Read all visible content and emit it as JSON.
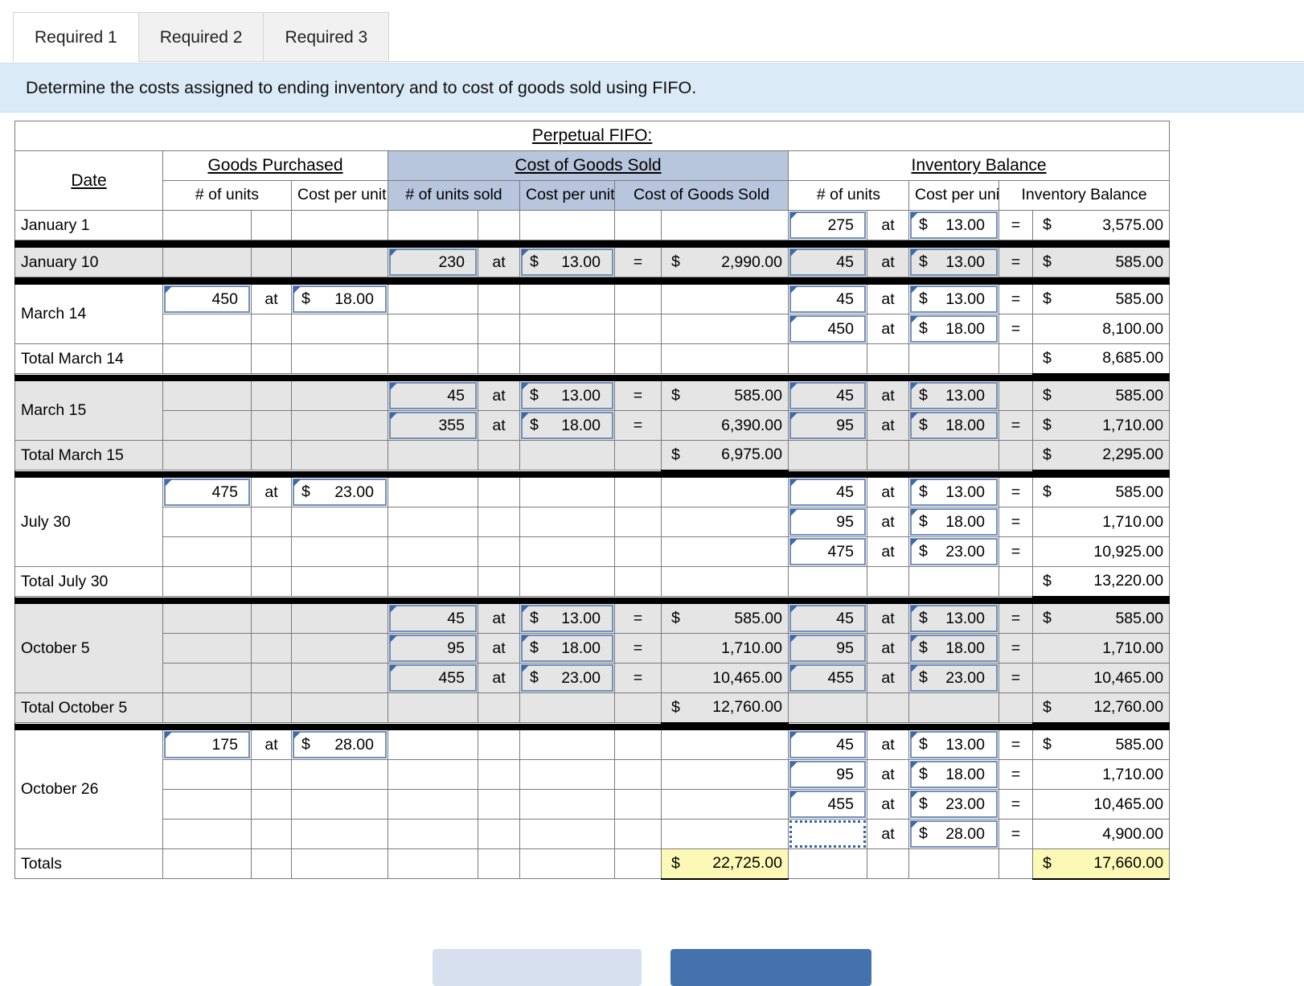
{
  "tabs": [
    {
      "label": "Required 1",
      "active": true
    },
    {
      "label": "Required 2",
      "active": false
    },
    {
      "label": "Required 3",
      "active": false
    }
  ],
  "prompt": "Determine the costs assigned to ending inventory and to cost of goods sold using FIFO.",
  "table": {
    "title": "Perpetual FIFO:",
    "group_headers": {
      "date": "Date",
      "goods_purchased": "Goods Purchased",
      "cost_of_goods_sold": "Cost of Goods Sold",
      "inventory_balance": "Inventory Balance"
    },
    "sub_headers": {
      "gp_units": "# of units",
      "gp_cost": "Cost per unit",
      "cogs_units": "# of units sold",
      "cogs_cost": "Cost per unit",
      "cogs_total": "Cost of Goods Sold",
      "inv_units": "# of units",
      "inv_cost": "Cost per unit",
      "inv_total": "Inventory Balance"
    },
    "ops": {
      "at": "at",
      "eq": "=",
      "dollar": "$"
    },
    "rows": [
      {
        "date": "January 1",
        "band": false,
        "lines": [
          {
            "gp_units": "",
            "gp_cost": "",
            "cogs_units": "",
            "cogs_cost": "",
            "cogs_total": "",
            "inv_units": "275",
            "inv_cost": "13.00",
            "inv_total": "3,575.00",
            "inv_total_sym": "$",
            "inv_eq": "="
          }
        ]
      },
      {
        "date": "January 10",
        "band": true,
        "lines": [
          {
            "gp_units": "",
            "gp_cost": "",
            "cogs_units": "230",
            "cogs_cost": "13.00",
            "cogs_total": "2,990.00",
            "cogs_total_sym": "$",
            "cogs_eq": "=",
            "inv_units": "45",
            "inv_cost": "13.00",
            "inv_total": "585.00",
            "inv_total_sym": "$",
            "inv_eq": "="
          }
        ]
      },
      {
        "date": "March 14",
        "band": false,
        "lines": [
          {
            "gp_units": "450",
            "gp_cost": "18.00",
            "cogs_units": "",
            "cogs_cost": "",
            "cogs_total": "",
            "inv_units": "45",
            "inv_cost": "13.00",
            "inv_total": "585.00",
            "inv_total_sym": "$",
            "inv_eq": "="
          },
          {
            "gp_units": "",
            "gp_cost": "",
            "cogs_units": "",
            "cogs_cost": "",
            "cogs_total": "",
            "inv_units": "450",
            "inv_cost": "18.00",
            "inv_total": "8,100.00",
            "inv_total_sym": "",
            "inv_eq": "="
          }
        ],
        "total_label": "Total March 14",
        "total_cogs": "",
        "total_cogs_sym": "",
        "total_inv": "8,685.00",
        "total_inv_sym": "$"
      },
      {
        "date": "March 15",
        "band": true,
        "lines": [
          {
            "gp_units": "",
            "gp_cost": "",
            "cogs_units": "45",
            "cogs_cost": "13.00",
            "cogs_total": "585.00",
            "cogs_total_sym": "$",
            "cogs_eq": "=",
            "inv_units": "45",
            "inv_cost": "13.00",
            "inv_total": "585.00",
            "inv_total_sym": "$",
            "inv_eq": ""
          },
          {
            "gp_units": "",
            "gp_cost": "",
            "cogs_units": "355",
            "cogs_cost": "18.00",
            "cogs_total": "6,390.00",
            "cogs_total_sym": "",
            "cogs_eq": "=",
            "inv_units": "95",
            "inv_cost": "18.00",
            "inv_total": "1,710.00",
            "inv_total_sym": "$",
            "inv_eq": "="
          }
        ],
        "total_label": "Total March 15",
        "total_cogs": "6,975.00",
        "total_cogs_sym": "$",
        "total_inv": "2,295.00",
        "total_inv_sym": "$"
      },
      {
        "date": "July 30",
        "band": false,
        "lines": [
          {
            "gp_units": "475",
            "gp_cost": "23.00",
            "cogs_units": "",
            "cogs_cost": "",
            "cogs_total": "",
            "inv_units": "45",
            "inv_cost": "13.00",
            "inv_total": "585.00",
            "inv_total_sym": "$",
            "inv_eq": "="
          },
          {
            "gp_units": "",
            "gp_cost": "",
            "cogs_units": "",
            "cogs_cost": "",
            "cogs_total": "",
            "inv_units": "95",
            "inv_cost": "18.00",
            "inv_total": "1,710.00",
            "inv_total_sym": "",
            "inv_eq": "="
          },
          {
            "gp_units": "",
            "gp_cost": "",
            "cogs_units": "",
            "cogs_cost": "",
            "cogs_total": "",
            "inv_units": "475",
            "inv_cost": "23.00",
            "inv_total": "10,925.00",
            "inv_total_sym": "",
            "inv_eq": "="
          }
        ],
        "total_label": "Total July 30",
        "total_cogs": "",
        "total_cogs_sym": "",
        "total_inv": "13,220.00",
        "total_inv_sym": "$"
      },
      {
        "date": "October 5",
        "band": true,
        "lines": [
          {
            "gp_units": "",
            "gp_cost": "",
            "cogs_units": "45",
            "cogs_cost": "13.00",
            "cogs_total": "585.00",
            "cogs_total_sym": "$",
            "cogs_eq": "=",
            "inv_units": "45",
            "inv_cost": "13.00",
            "inv_total": "585.00",
            "inv_total_sym": "$",
            "inv_eq": "="
          },
          {
            "gp_units": "",
            "gp_cost": "",
            "cogs_units": "95",
            "cogs_cost": "18.00",
            "cogs_total": "1,710.00",
            "cogs_total_sym": "",
            "cogs_eq": "=",
            "inv_units": "95",
            "inv_cost": "18.00",
            "inv_total": "1,710.00",
            "inv_total_sym": "",
            "inv_eq": "="
          },
          {
            "gp_units": "",
            "gp_cost": "",
            "cogs_units": "455",
            "cogs_cost": "23.00",
            "cogs_total": "10,465.00",
            "cogs_total_sym": "",
            "cogs_eq": "=",
            "inv_units": "455",
            "inv_cost": "23.00",
            "inv_total": "10,465.00",
            "inv_total_sym": "",
            "inv_eq": "="
          }
        ],
        "total_label": "Total October 5",
        "total_cogs": "12,760.00",
        "total_cogs_sym": "$",
        "total_inv": "12,760.00",
        "total_inv_sym": "$"
      },
      {
        "date": "October 26",
        "band": false,
        "lines": [
          {
            "gp_units": "175",
            "gp_cost": "28.00",
            "cogs_units": "",
            "cogs_cost": "",
            "cogs_total": "",
            "inv_units": "45",
            "inv_cost": "13.00",
            "inv_total": "585.00",
            "inv_total_sym": "$",
            "inv_eq": "="
          },
          {
            "gp_units": "",
            "gp_cost": "",
            "cogs_units": "",
            "cogs_cost": "",
            "cogs_total": "",
            "inv_units": "95",
            "inv_cost": "18.00",
            "inv_total": "1,710.00",
            "inv_total_sym": "",
            "inv_eq": "="
          },
          {
            "gp_units": "",
            "gp_cost": "",
            "cogs_units": "",
            "cogs_cost": "",
            "cogs_total": "",
            "inv_units": "455",
            "inv_cost": "23.00",
            "inv_total": "10,465.00",
            "inv_total_sym": "",
            "inv_eq": "="
          },
          {
            "gp_units": "",
            "gp_cost": "",
            "cogs_units": "",
            "cogs_cost": "",
            "cogs_total": "",
            "inv_units": "",
            "inv_units_focus": true,
            "inv_cost": "28.00",
            "inv_total": "4,900.00",
            "inv_total_sym": "",
            "inv_eq": "="
          }
        ]
      }
    ],
    "totals_row": {
      "label": "Totals",
      "cogs_sym": "$",
      "cogs_value": "22,725.00",
      "inv_sym": "$",
      "inv_value": "17,660.00"
    }
  },
  "footer_buttons": {
    "prev": "",
    "next": ""
  }
}
